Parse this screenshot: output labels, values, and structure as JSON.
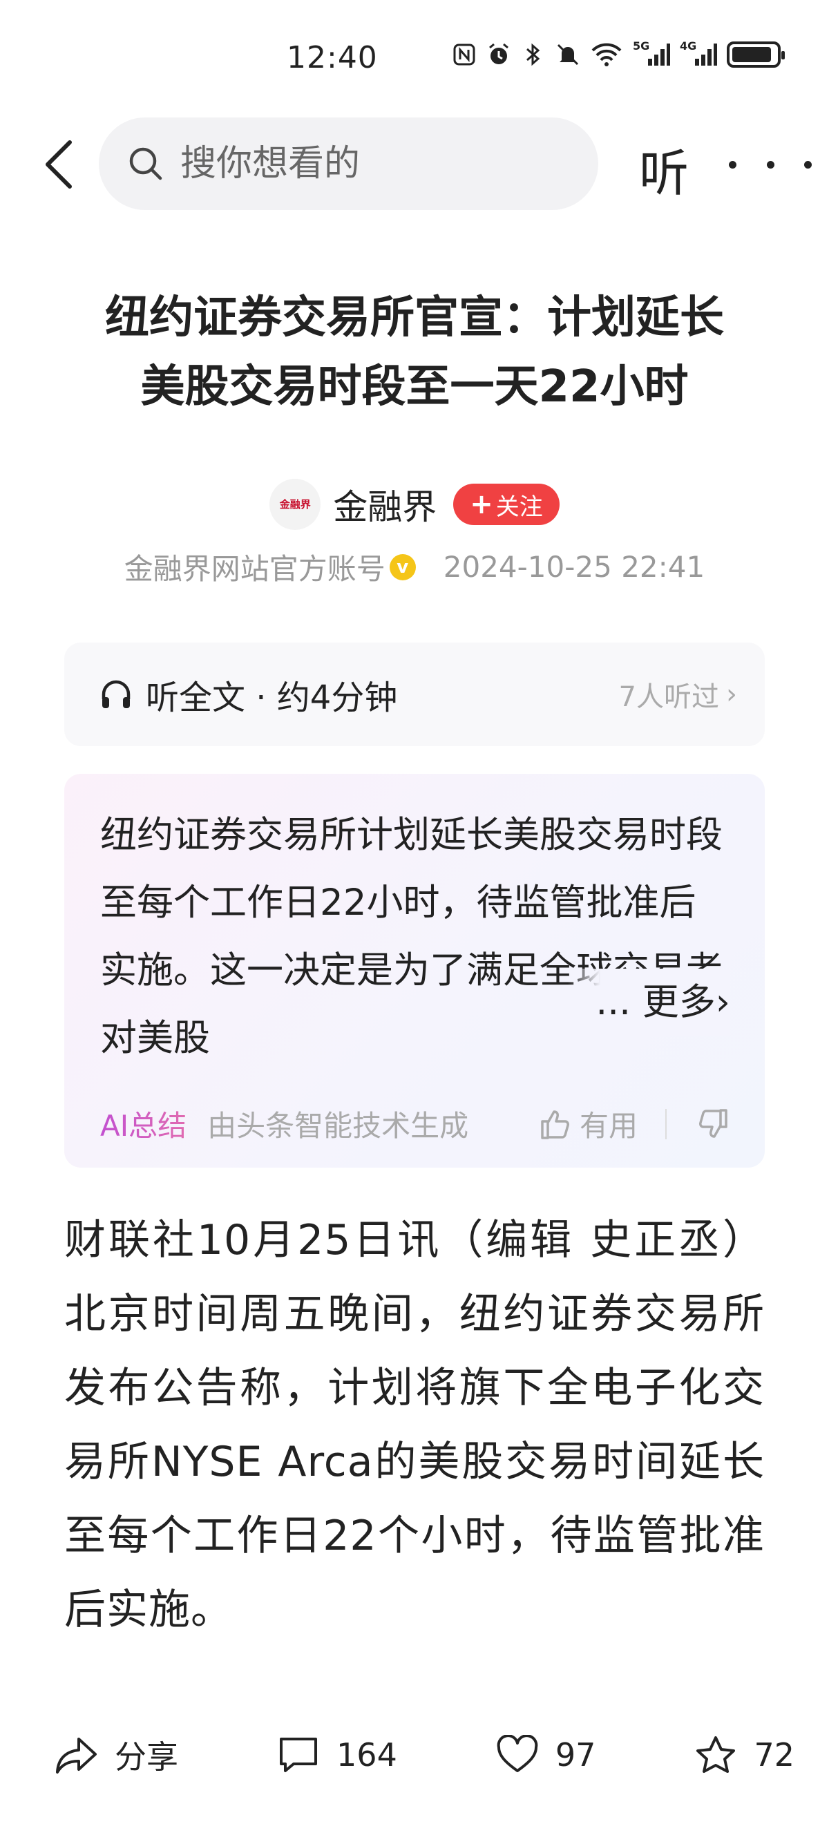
{
  "status_bar": {
    "time": "12:40",
    "network_label": "5G",
    "network_label_2": "4G"
  },
  "top_bar": {
    "search_placeholder": "搜你想看的",
    "listen_label": "听"
  },
  "article": {
    "title_line1": "纽约证券交易所官宣：计划延长",
    "title_line2": "美股交易时段至一天22小时",
    "author_name": "金融界",
    "author_logo_text": "金融界",
    "follow_label": "关注",
    "account_desc": "金融界网站官方账号",
    "verified_mark": "v",
    "publish_time": "2024-10-25  22:41",
    "body": "财联社10月25日讯（编辑 史正丞）北京时间周五晚间，纽约证券交易所发布公告称，计划将旗下全电子化交易所NYSE Arca的美股交易时间延长至每个工作日22个小时，待监管批准后实施。"
  },
  "listen_card": {
    "label": "听全文 · 约4分钟",
    "count": "7人听过"
  },
  "ai_summary": {
    "text": "纽约证券交易所计划延长美股交易时段至每个工作日22小时，待监管批准后实施。这一决定是为了满足全球交易者对美股",
    "more_label": "... 更多",
    "badge": "AI总结",
    "source": "由头条智能技术生成",
    "useful_label": "有用"
  },
  "bottom_bar": {
    "share_label": "分享",
    "comment_count": "164",
    "like_count": "97",
    "favorite_count": "72"
  },
  "colors": {
    "follow_red": "#f04142",
    "verified_yellow": "#f5c518",
    "ai_purple": "#c24fd0"
  }
}
